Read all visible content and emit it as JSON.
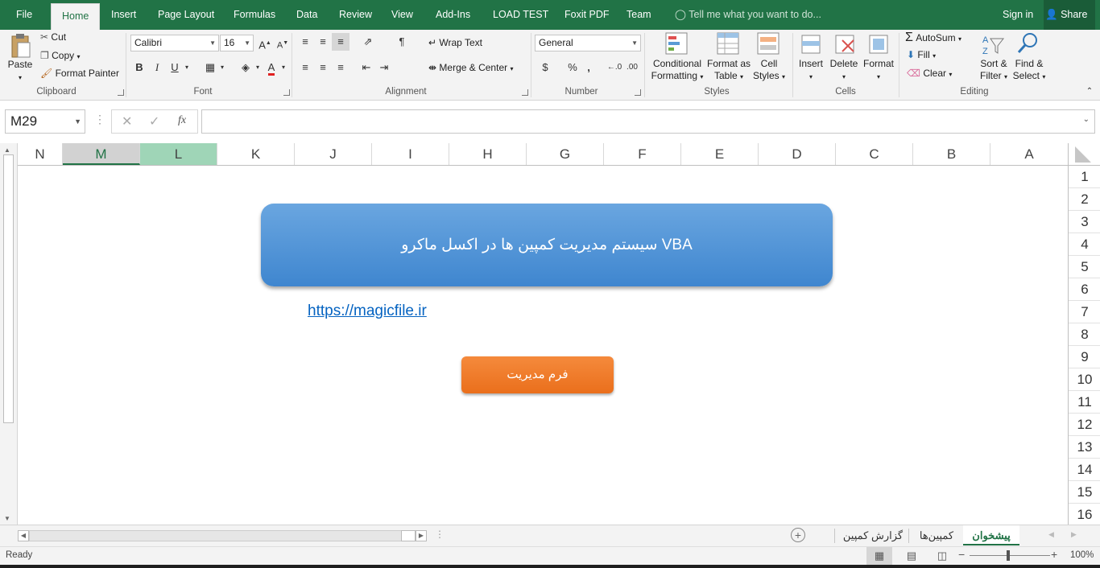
{
  "ribbon_tabs": {
    "file": "File",
    "home": "Home",
    "insert": "Insert",
    "page_layout": "Page Layout",
    "formulas": "Formulas",
    "data": "Data",
    "review": "Review",
    "view": "View",
    "addins": "Add-Ins",
    "load_test": "LOAD TEST",
    "foxit": "Foxit PDF",
    "team": "Team"
  },
  "tell_me": "Tell me what you want to do...",
  "sign_in": "Sign in",
  "share": "Share",
  "clipboard": {
    "paste": "Paste",
    "cut": "Cut",
    "copy": "Copy",
    "format_painter": "Format Painter",
    "group": "Clipboard"
  },
  "font": {
    "name": "Calibri",
    "size": "16",
    "group": "Font",
    "bold": "B",
    "italic": "I",
    "underline": "U",
    "font_color_letter": "A",
    "font_color": "#e02020"
  },
  "alignment": {
    "wrap_text": "Wrap Text",
    "merge_center": "Merge & Center",
    "group": "Alignment"
  },
  "number": {
    "format": "General",
    "currency": "$",
    "percent": "%",
    "comma": ",",
    "group": "Number"
  },
  "styles": {
    "conditional_1": "Conditional",
    "conditional_2": "Formatting",
    "format_table_1": "Format as",
    "format_table_2": "Table",
    "cell_styles_1": "Cell",
    "cell_styles_2": "Styles",
    "group": "Styles"
  },
  "cells": {
    "insert": "Insert",
    "delete": "Delete",
    "format": "Format",
    "group": "Cells"
  },
  "editing": {
    "autosum": "AutoSum",
    "fill": "Fill",
    "clear": "Clear",
    "sort_1": "Sort &",
    "sort_2": "Filter",
    "find_1": "Find &",
    "find_2": "Select",
    "group": "Editing"
  },
  "formula_bar": {
    "name_box": "M29",
    "fx": "fx",
    "formula": ""
  },
  "columns": [
    "N",
    "M",
    "L",
    "K",
    "J",
    "I",
    "H",
    "G",
    "F",
    "E",
    "D",
    "C",
    "B",
    "A"
  ],
  "rows": [
    "1",
    "2",
    "3",
    "4",
    "5",
    "6",
    "7",
    "8",
    "9",
    "10",
    "11",
    "12",
    "13",
    "14",
    "15",
    "16"
  ],
  "sheet": {
    "title": "سیستم مدیریت کمپین ها در اکسل ماکرو VBA",
    "link": "https://magicfile.ir",
    "form_button": "فرم مدیریت"
  },
  "sheet_tabs": [
    "گزارش کمپین",
    "کمپین‌ها",
    "پیشخوان"
  ],
  "status": {
    "ready": "Ready",
    "zoom": "100%"
  },
  "colors": {
    "excel_green": "#217346",
    "title_shape": "#4a90d9",
    "form_button": "#ed7d31"
  }
}
